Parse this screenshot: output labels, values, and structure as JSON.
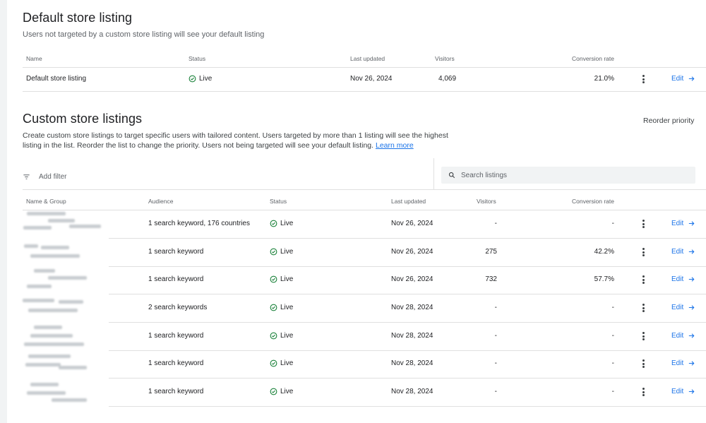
{
  "default_section": {
    "title": "Default store listing",
    "subtitle": "Users not targeted by a custom store listing will see your default listing",
    "columns": [
      "Name",
      "Status",
      "Last updated",
      "Visitors",
      "Conversion rate"
    ],
    "row": {
      "name": "Default store listing",
      "status": "Live",
      "last_updated": "Nov 26, 2024",
      "visitors": "4,069",
      "conversion_rate": "21.0%",
      "edit": "Edit"
    }
  },
  "custom_section": {
    "title": "Custom store listings",
    "reorder_label": "Reorder priority",
    "description": "Create custom store listings to target specific users with tailored content. Users targeted by more than 1 listing will see the highest listing in the list. Reorder the list to change the priority. Users not being targeted will see your default listing.",
    "learn_more": "Learn more",
    "filter_label": "Add filter",
    "search_placeholder": "Search listings",
    "columns": [
      "Name & Group",
      "Audience",
      "Status",
      "Last updated",
      "Visitors",
      "Conversion rate"
    ],
    "rows": [
      {
        "audience": "1 search keyword, 176 countries",
        "status": "Live",
        "last_updated": "Nov 26, 2024",
        "visitors": "-",
        "conversion_rate": "-",
        "edit": "Edit"
      },
      {
        "audience": "1 search keyword",
        "status": "Live",
        "last_updated": "Nov 26, 2024",
        "visitors": "275",
        "conversion_rate": "42.2%",
        "edit": "Edit"
      },
      {
        "audience": "1 search keyword",
        "status": "Live",
        "last_updated": "Nov 26, 2024",
        "visitors": "732",
        "conversion_rate": "57.7%",
        "edit": "Edit"
      },
      {
        "audience": "2 search keywords",
        "status": "Live",
        "last_updated": "Nov 28, 2024",
        "visitors": "-",
        "conversion_rate": "-",
        "edit": "Edit"
      },
      {
        "audience": "1 search keyword",
        "status": "Live",
        "last_updated": "Nov 28, 2024",
        "visitors": "-",
        "conversion_rate": "-",
        "edit": "Edit"
      },
      {
        "audience": "1 search keyword",
        "status": "Live",
        "last_updated": "Nov 28, 2024",
        "visitors": "-",
        "conversion_rate": "-",
        "edit": "Edit"
      },
      {
        "audience": "1 search keyword",
        "status": "Live",
        "last_updated": "Nov 28, 2024",
        "visitors": "-",
        "conversion_rate": "-",
        "edit": "Edit"
      }
    ]
  },
  "icons": {
    "status": "check-circle-icon",
    "edit": "arrow-right-icon",
    "menu": "more-vert-icon",
    "filter": "filter-list-icon",
    "search": "search-icon"
  },
  "colors": {
    "live_green": "#188038",
    "link_blue": "#1a73e8",
    "divider": "#e0e0e0",
    "search_bg": "#f1f3f4"
  }
}
